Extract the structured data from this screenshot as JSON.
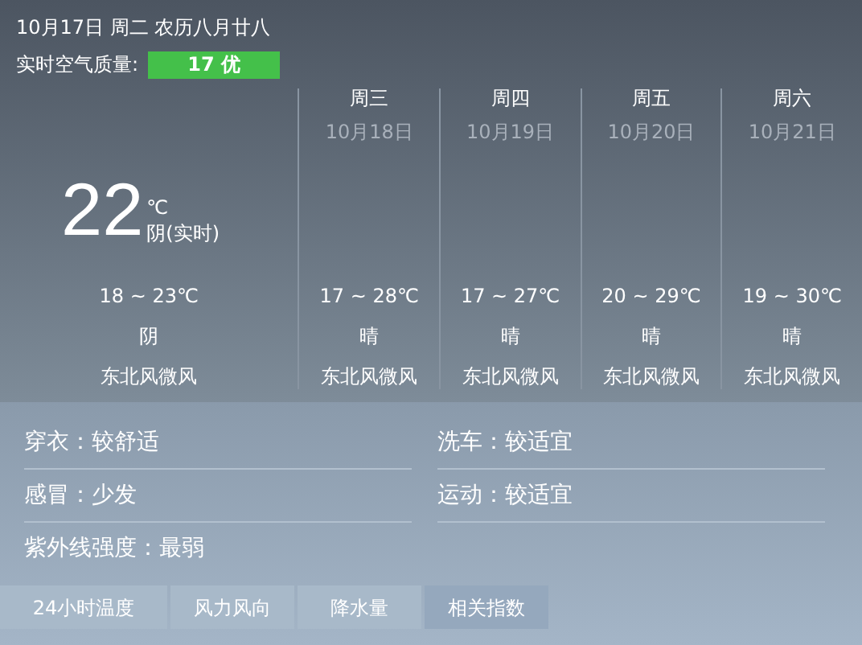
{
  "header": {
    "date": "10月17日 周二 农历八月廿八",
    "aqi_label": "实时空气质量:",
    "aqi_value": "17 优"
  },
  "today": {
    "temp": "22",
    "unit": "℃",
    "condition": "阴(实时)",
    "range": "18 ~ 23℃",
    "weather": "阴",
    "wind": "东北风微风"
  },
  "forecast": [
    {
      "day": "周三",
      "date": "10月18日",
      "range": "17 ~ 28℃",
      "weather": "晴",
      "wind": "东北风微风"
    },
    {
      "day": "周四",
      "date": "10月19日",
      "range": "17 ~ 27℃",
      "weather": "晴",
      "wind": "东北风微风"
    },
    {
      "day": "周五",
      "date": "10月20日",
      "range": "20 ~ 29℃",
      "weather": "晴",
      "wind": "东北风微风"
    },
    {
      "day": "周六",
      "date": "10月21日",
      "range": "19 ~ 30℃",
      "weather": "晴",
      "wind": "东北风微风"
    }
  ],
  "indices": [
    {
      "label": "穿衣：较舒适"
    },
    {
      "label": "洗车：较适宜"
    },
    {
      "label": "感冒：少发"
    },
    {
      "label": "运动：较适宜"
    },
    {
      "label": "紫外线强度：最弱"
    }
  ],
  "tabs": [
    {
      "label": "24小时温度",
      "selected": false
    },
    {
      "label": "风力风向",
      "selected": false
    },
    {
      "label": "降水量",
      "selected": false
    },
    {
      "label": "相关指数",
      "selected": true
    }
  ]
}
